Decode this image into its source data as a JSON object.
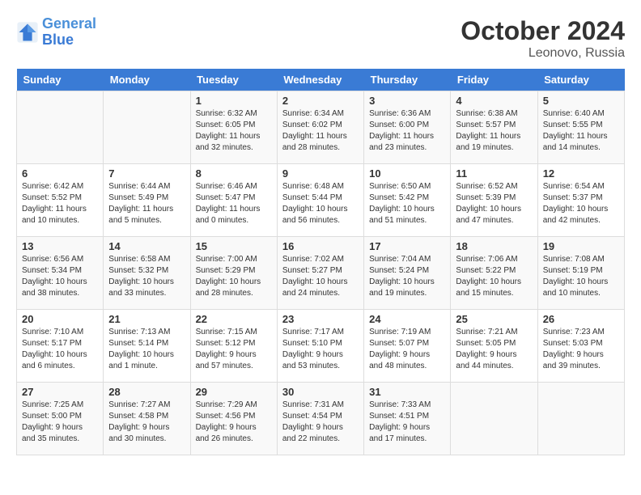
{
  "logo": {
    "line1": "General",
    "line2": "Blue"
  },
  "title": "October 2024",
  "location": "Leonovo, Russia",
  "weekdays": [
    "Sunday",
    "Monday",
    "Tuesday",
    "Wednesday",
    "Thursday",
    "Friday",
    "Saturday"
  ],
  "weeks": [
    [
      {
        "day": "",
        "sunrise": "",
        "sunset": "",
        "daylight": ""
      },
      {
        "day": "",
        "sunrise": "",
        "sunset": "",
        "daylight": ""
      },
      {
        "day": "1",
        "sunrise": "Sunrise: 6:32 AM",
        "sunset": "Sunset: 6:05 PM",
        "daylight": "Daylight: 11 hours and 32 minutes."
      },
      {
        "day": "2",
        "sunrise": "Sunrise: 6:34 AM",
        "sunset": "Sunset: 6:02 PM",
        "daylight": "Daylight: 11 hours and 28 minutes."
      },
      {
        "day": "3",
        "sunrise": "Sunrise: 6:36 AM",
        "sunset": "Sunset: 6:00 PM",
        "daylight": "Daylight: 11 hours and 23 minutes."
      },
      {
        "day": "4",
        "sunrise": "Sunrise: 6:38 AM",
        "sunset": "Sunset: 5:57 PM",
        "daylight": "Daylight: 11 hours and 19 minutes."
      },
      {
        "day": "5",
        "sunrise": "Sunrise: 6:40 AM",
        "sunset": "Sunset: 5:55 PM",
        "daylight": "Daylight: 11 hours and 14 minutes."
      }
    ],
    [
      {
        "day": "6",
        "sunrise": "Sunrise: 6:42 AM",
        "sunset": "Sunset: 5:52 PM",
        "daylight": "Daylight: 11 hours and 10 minutes."
      },
      {
        "day": "7",
        "sunrise": "Sunrise: 6:44 AM",
        "sunset": "Sunset: 5:49 PM",
        "daylight": "Daylight: 11 hours and 5 minutes."
      },
      {
        "day": "8",
        "sunrise": "Sunrise: 6:46 AM",
        "sunset": "Sunset: 5:47 PM",
        "daylight": "Daylight: 11 hours and 0 minutes."
      },
      {
        "day": "9",
        "sunrise": "Sunrise: 6:48 AM",
        "sunset": "Sunset: 5:44 PM",
        "daylight": "Daylight: 10 hours and 56 minutes."
      },
      {
        "day": "10",
        "sunrise": "Sunrise: 6:50 AM",
        "sunset": "Sunset: 5:42 PM",
        "daylight": "Daylight: 10 hours and 51 minutes."
      },
      {
        "day": "11",
        "sunrise": "Sunrise: 6:52 AM",
        "sunset": "Sunset: 5:39 PM",
        "daylight": "Daylight: 10 hours and 47 minutes."
      },
      {
        "day": "12",
        "sunrise": "Sunrise: 6:54 AM",
        "sunset": "Sunset: 5:37 PM",
        "daylight": "Daylight: 10 hours and 42 minutes."
      }
    ],
    [
      {
        "day": "13",
        "sunrise": "Sunrise: 6:56 AM",
        "sunset": "Sunset: 5:34 PM",
        "daylight": "Daylight: 10 hours and 38 minutes."
      },
      {
        "day": "14",
        "sunrise": "Sunrise: 6:58 AM",
        "sunset": "Sunset: 5:32 PM",
        "daylight": "Daylight: 10 hours and 33 minutes."
      },
      {
        "day": "15",
        "sunrise": "Sunrise: 7:00 AM",
        "sunset": "Sunset: 5:29 PM",
        "daylight": "Daylight: 10 hours and 28 minutes."
      },
      {
        "day": "16",
        "sunrise": "Sunrise: 7:02 AM",
        "sunset": "Sunset: 5:27 PM",
        "daylight": "Daylight: 10 hours and 24 minutes."
      },
      {
        "day": "17",
        "sunrise": "Sunrise: 7:04 AM",
        "sunset": "Sunset: 5:24 PM",
        "daylight": "Daylight: 10 hours and 19 minutes."
      },
      {
        "day": "18",
        "sunrise": "Sunrise: 7:06 AM",
        "sunset": "Sunset: 5:22 PM",
        "daylight": "Daylight: 10 hours and 15 minutes."
      },
      {
        "day": "19",
        "sunrise": "Sunrise: 7:08 AM",
        "sunset": "Sunset: 5:19 PM",
        "daylight": "Daylight: 10 hours and 10 minutes."
      }
    ],
    [
      {
        "day": "20",
        "sunrise": "Sunrise: 7:10 AM",
        "sunset": "Sunset: 5:17 PM",
        "daylight": "Daylight: 10 hours and 6 minutes."
      },
      {
        "day": "21",
        "sunrise": "Sunrise: 7:13 AM",
        "sunset": "Sunset: 5:14 PM",
        "daylight": "Daylight: 10 hours and 1 minute."
      },
      {
        "day": "22",
        "sunrise": "Sunrise: 7:15 AM",
        "sunset": "Sunset: 5:12 PM",
        "daylight": "Daylight: 9 hours and 57 minutes."
      },
      {
        "day": "23",
        "sunrise": "Sunrise: 7:17 AM",
        "sunset": "Sunset: 5:10 PM",
        "daylight": "Daylight: 9 hours and 53 minutes."
      },
      {
        "day": "24",
        "sunrise": "Sunrise: 7:19 AM",
        "sunset": "Sunset: 5:07 PM",
        "daylight": "Daylight: 9 hours and 48 minutes."
      },
      {
        "day": "25",
        "sunrise": "Sunrise: 7:21 AM",
        "sunset": "Sunset: 5:05 PM",
        "daylight": "Daylight: 9 hours and 44 minutes."
      },
      {
        "day": "26",
        "sunrise": "Sunrise: 7:23 AM",
        "sunset": "Sunset: 5:03 PM",
        "daylight": "Daylight: 9 hours and 39 minutes."
      }
    ],
    [
      {
        "day": "27",
        "sunrise": "Sunrise: 7:25 AM",
        "sunset": "Sunset: 5:00 PM",
        "daylight": "Daylight: 9 hours and 35 minutes."
      },
      {
        "day": "28",
        "sunrise": "Sunrise: 7:27 AM",
        "sunset": "Sunset: 4:58 PM",
        "daylight": "Daylight: 9 hours and 30 minutes."
      },
      {
        "day": "29",
        "sunrise": "Sunrise: 7:29 AM",
        "sunset": "Sunset: 4:56 PM",
        "daylight": "Daylight: 9 hours and 26 minutes."
      },
      {
        "day": "30",
        "sunrise": "Sunrise: 7:31 AM",
        "sunset": "Sunset: 4:54 PM",
        "daylight": "Daylight: 9 hours and 22 minutes."
      },
      {
        "day": "31",
        "sunrise": "Sunrise: 7:33 AM",
        "sunset": "Sunset: 4:51 PM",
        "daylight": "Daylight: 9 hours and 17 minutes."
      },
      {
        "day": "",
        "sunrise": "",
        "sunset": "",
        "daylight": ""
      },
      {
        "day": "",
        "sunrise": "",
        "sunset": "",
        "daylight": ""
      }
    ]
  ]
}
